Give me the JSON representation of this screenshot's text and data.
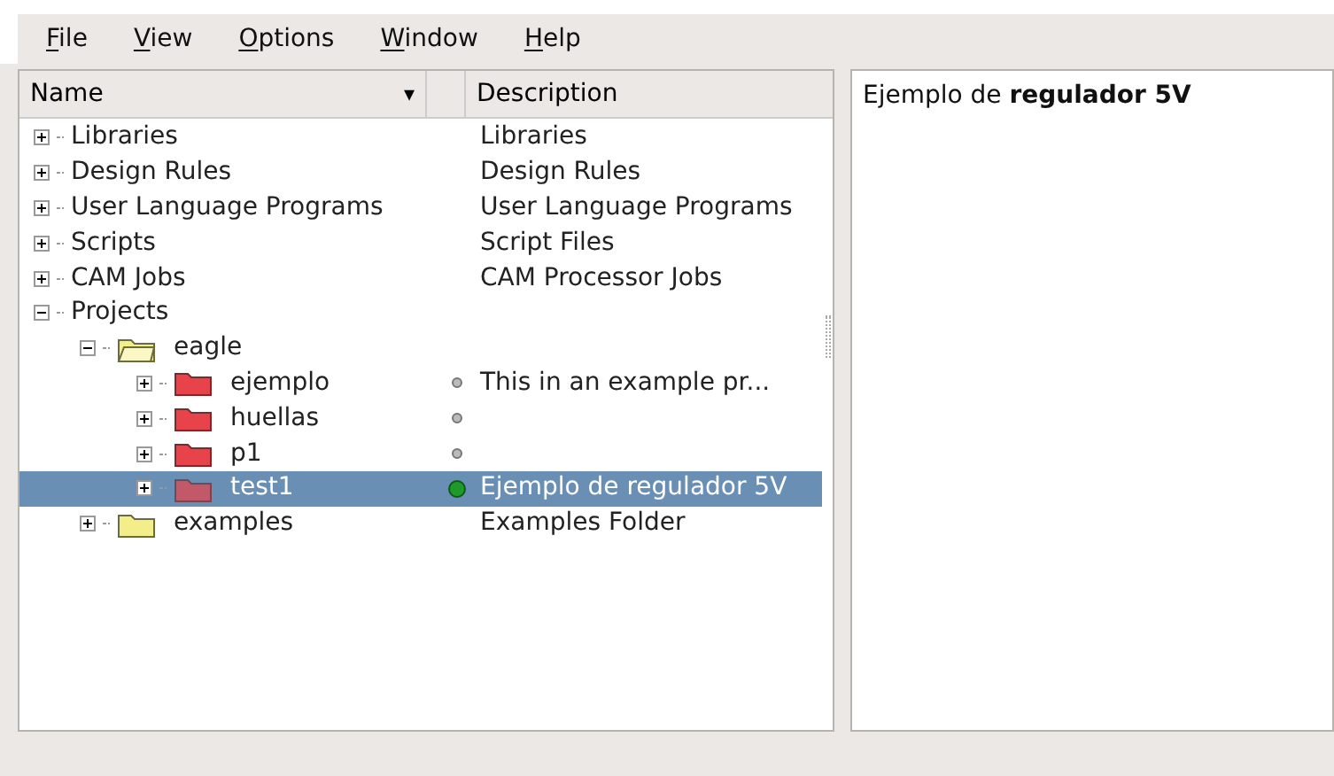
{
  "menu": [
    {
      "label": "File"
    },
    {
      "label": "View"
    },
    {
      "label": "Options"
    },
    {
      "label": "Window"
    },
    {
      "label": "Help"
    }
  ],
  "tree": {
    "columns": [
      {
        "label": "Name",
        "sort": "▾"
      },
      {
        "label": "Description"
      }
    ],
    "items": [
      {
        "name": "Libraries",
        "description": "Libraries",
        "kind": "category",
        "expanded": false,
        "selected": false
      },
      {
        "name": "Design Rules",
        "description": "Design Rules",
        "kind": "category",
        "expanded": false,
        "selected": false
      },
      {
        "name": "User Language Programs",
        "description": "User Language Programs",
        "kind": "category",
        "expanded": false,
        "selected": false
      },
      {
        "name": "Scripts",
        "description": "Script Files",
        "kind": "category",
        "expanded": false,
        "selected": false
      },
      {
        "name": "CAM Jobs",
        "description": "CAM Processor Jobs",
        "kind": "category",
        "expanded": false,
        "selected": false
      },
      {
        "name": "Projects",
        "kind": "category",
        "expanded": true,
        "selected": false,
        "children": [
          {
            "name": "eagle",
            "kind": "folder",
            "expanded": true,
            "selected": false,
            "children": [
              {
                "name": "ejemplo",
                "description": "This in an  example  pr...",
                "kind": "project",
                "expanded": false,
                "open": false,
                "selected": false
              },
              {
                "name": "huellas",
                "kind": "project",
                "expanded": false,
                "open": false,
                "selected": false
              },
              {
                "name": "p1",
                "kind": "project",
                "expanded": false,
                "open": false,
                "selected": false
              },
              {
                "name": "test1",
                "description": "Ejemplo de regulador 5V",
                "kind": "project",
                "expanded": false,
                "open": true,
                "selected": true
              }
            ]
          },
          {
            "name": "examples",
            "description": "Examples Folder",
            "kind": "folder",
            "expanded": false,
            "selected": false
          }
        ]
      }
    ]
  },
  "preview": {
    "text": "Ejemplo de **regulador 5V**"
  }
}
